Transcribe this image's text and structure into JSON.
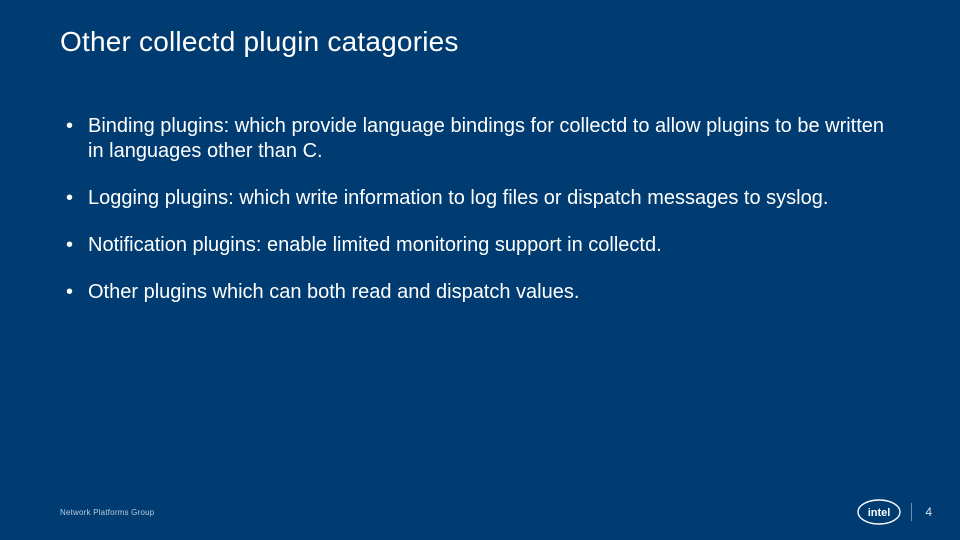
{
  "title": "Other collectd plugin catagories",
  "bullets": [
    "Binding plugins: which provide language bindings for collectd to allow plugins to be written in languages other than C.",
    "Logging plugins: which write information to log files or dispatch messages to syslog.",
    "Notification plugins: enable limited monitoring support in collectd.",
    "Other plugins which can both read and dispatch values."
  ],
  "footer": {
    "group": "Network Platforms Group",
    "page": "4",
    "logo_label": "intel"
  }
}
